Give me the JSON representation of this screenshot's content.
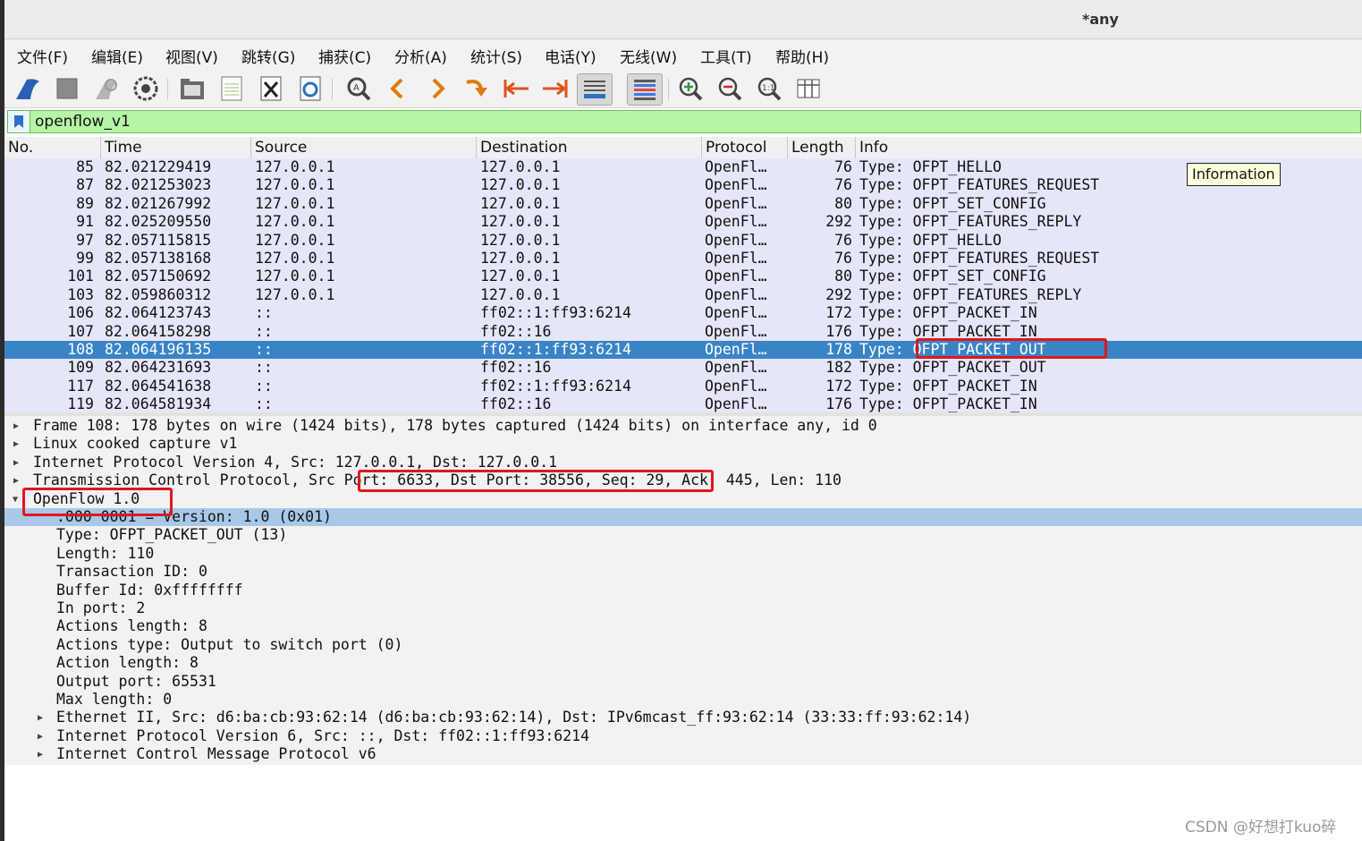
{
  "window": {
    "title": "*any"
  },
  "menu": [
    "文件(F)",
    "编辑(E)",
    "视图(V)",
    "跳转(G)",
    "捕获(C)",
    "分析(A)",
    "统计(S)",
    "电话(Y)",
    "无线(W)",
    "工具(T)",
    "帮助(H)"
  ],
  "toolbar_icons": [
    "shark-fin-icon",
    "stop-icon",
    "restart-icon",
    "options-gear-icon",
    "open-folder-icon",
    "save-file-icon",
    "close-file-icon",
    "reload-icon",
    "find-icon",
    "back-arrow-icon",
    "forward-arrow-icon",
    "goto-packet-icon",
    "first-packet-icon",
    "last-packet-icon",
    "autoscroll-icon",
    "colorize-icon",
    "zoom-in-icon",
    "zoom-out-icon",
    "zoom-normal-icon",
    "resize-columns-icon"
  ],
  "filter": {
    "value": "openflow_v1"
  },
  "columns": [
    "No.",
    "Time",
    "Source",
    "Destination",
    "Protocol",
    "Length",
    "Info"
  ],
  "packets": [
    {
      "no": "85",
      "time": "82.021229419",
      "src": "127.0.0.1",
      "dst": "127.0.0.1",
      "proto": "OpenFl…",
      "len": "76",
      "info": "Type: OFPT_HELLO"
    },
    {
      "no": "87",
      "time": "82.021253023",
      "src": "127.0.0.1",
      "dst": "127.0.0.1",
      "proto": "OpenFl…",
      "len": "76",
      "info": "Type: OFPT_FEATURES_REQUEST"
    },
    {
      "no": "89",
      "time": "82.021267992",
      "src": "127.0.0.1",
      "dst": "127.0.0.1",
      "proto": "OpenFl…",
      "len": "80",
      "info": "Type: OFPT_SET_CONFIG"
    },
    {
      "no": "91",
      "time": "82.025209550",
      "src": "127.0.0.1",
      "dst": "127.0.0.1",
      "proto": "OpenFl…",
      "len": "292",
      "info": "Type: OFPT_FEATURES_REPLY"
    },
    {
      "no": "97",
      "time": "82.057115815",
      "src": "127.0.0.1",
      "dst": "127.0.0.1",
      "proto": "OpenFl…",
      "len": "76",
      "info": "Type: OFPT_HELLO"
    },
    {
      "no": "99",
      "time": "82.057138168",
      "src": "127.0.0.1",
      "dst": "127.0.0.1",
      "proto": "OpenFl…",
      "len": "76",
      "info": "Type: OFPT_FEATURES_REQUEST"
    },
    {
      "no": "101",
      "time": "82.057150692",
      "src": "127.0.0.1",
      "dst": "127.0.0.1",
      "proto": "OpenFl…",
      "len": "80",
      "info": "Type: OFPT_SET_CONFIG"
    },
    {
      "no": "103",
      "time": "82.059860312",
      "src": "127.0.0.1",
      "dst": "127.0.0.1",
      "proto": "OpenFl…",
      "len": "292",
      "info": "Type: OFPT_FEATURES_REPLY"
    },
    {
      "no": "106",
      "time": "82.064123743",
      "src": "::",
      "dst": "ff02::1:ff93:6214",
      "proto": "OpenFl…",
      "len": "172",
      "info": "Type: OFPT_PACKET_IN"
    },
    {
      "no": "107",
      "time": "82.064158298",
      "src": "::",
      "dst": "ff02::16",
      "proto": "OpenFl…",
      "len": "176",
      "info": "Type: OFPT_PACKET_IN"
    },
    {
      "no": "108",
      "time": "82.064196135",
      "src": "::",
      "dst": "ff02::1:ff93:6214",
      "proto": "OpenFl…",
      "len": "178",
      "info": "Type: OFPT_PACKET_OUT",
      "selected": true
    },
    {
      "no": "109",
      "time": "82.064231693",
      "src": "::",
      "dst": "ff02::16",
      "proto": "OpenFl…",
      "len": "182",
      "info": "Type: OFPT_PACKET_OUT"
    },
    {
      "no": "117",
      "time": "82.064541638",
      "src": "::",
      "dst": "ff02::1:ff93:6214",
      "proto": "OpenFl…",
      "len": "172",
      "info": "Type: OFPT_PACKET_IN"
    },
    {
      "no": "119",
      "time": "82.064581934",
      "src": "::",
      "dst": "ff02::16",
      "proto": "OpenFl…",
      "len": "176",
      "info": "Type: OFPT_PACKET_IN"
    }
  ],
  "tooltip": "Information",
  "details": [
    {
      "text": "Frame 108: 178 bytes on wire (1424 bits), 178 bytes captured (1424 bits) on interface any, id 0",
      "level": 0,
      "arrow": "collapsed"
    },
    {
      "text": "Linux cooked capture v1",
      "level": 0,
      "arrow": "collapsed"
    },
    {
      "text": "Internet Protocol Version 4, Src: 127.0.0.1, Dst: 127.0.0.1",
      "level": 0,
      "arrow": "collapsed"
    },
    {
      "text": "Transmission Control Protocol, Src Port: 6633, Dst Port: 38556, Seq: 29, Ack: 445, Len: 110",
      "level": 0,
      "arrow": "collapsed"
    },
    {
      "text": "OpenFlow 1.0",
      "level": 0,
      "arrow": "expanded"
    },
    {
      "text": ".000 0001 = Version: 1.0 (0x01)",
      "level": 1,
      "arrow": "none",
      "highlight": true
    },
    {
      "text": "Type: OFPT_PACKET_OUT (13)",
      "level": 1,
      "arrow": "none"
    },
    {
      "text": "Length: 110",
      "level": 1,
      "arrow": "none"
    },
    {
      "text": "Transaction ID: 0",
      "level": 1,
      "arrow": "none"
    },
    {
      "text": "Buffer Id: 0xffffffff",
      "level": 1,
      "arrow": "none"
    },
    {
      "text": "In port: 2",
      "level": 1,
      "arrow": "none"
    },
    {
      "text": "Actions length: 8",
      "level": 1,
      "arrow": "none"
    },
    {
      "text": "Actions type: Output to switch port (0)",
      "level": 1,
      "arrow": "none"
    },
    {
      "text": "Action length: 8",
      "level": 1,
      "arrow": "none"
    },
    {
      "text": "Output port: 65531",
      "level": 1,
      "arrow": "none"
    },
    {
      "text": "Max length: 0",
      "level": 1,
      "arrow": "none"
    },
    {
      "text": "Ethernet II, Src: d6:ba:cb:93:62:14 (d6:ba:cb:93:62:14), Dst: IPv6mcast_ff:93:62:14 (33:33:ff:93:62:14)",
      "level": 1,
      "arrow": "collapsed"
    },
    {
      "text": "Internet Protocol Version 6, Src: ::, Dst: ff02::1:ff93:6214",
      "level": 1,
      "arrow": "collapsed"
    },
    {
      "text": "Internet Control Message Protocol v6",
      "level": 1,
      "arrow": "collapsed"
    }
  ],
  "watermark": "CSDN @好想打kuo碎",
  "colors": {
    "selected_row": "#3a84c6",
    "packet_bg": "#e6e6fa",
    "filter_bg": "#b7f4a6",
    "annotation": "#e0161e",
    "detail_highlight": "#a8c8e8"
  }
}
